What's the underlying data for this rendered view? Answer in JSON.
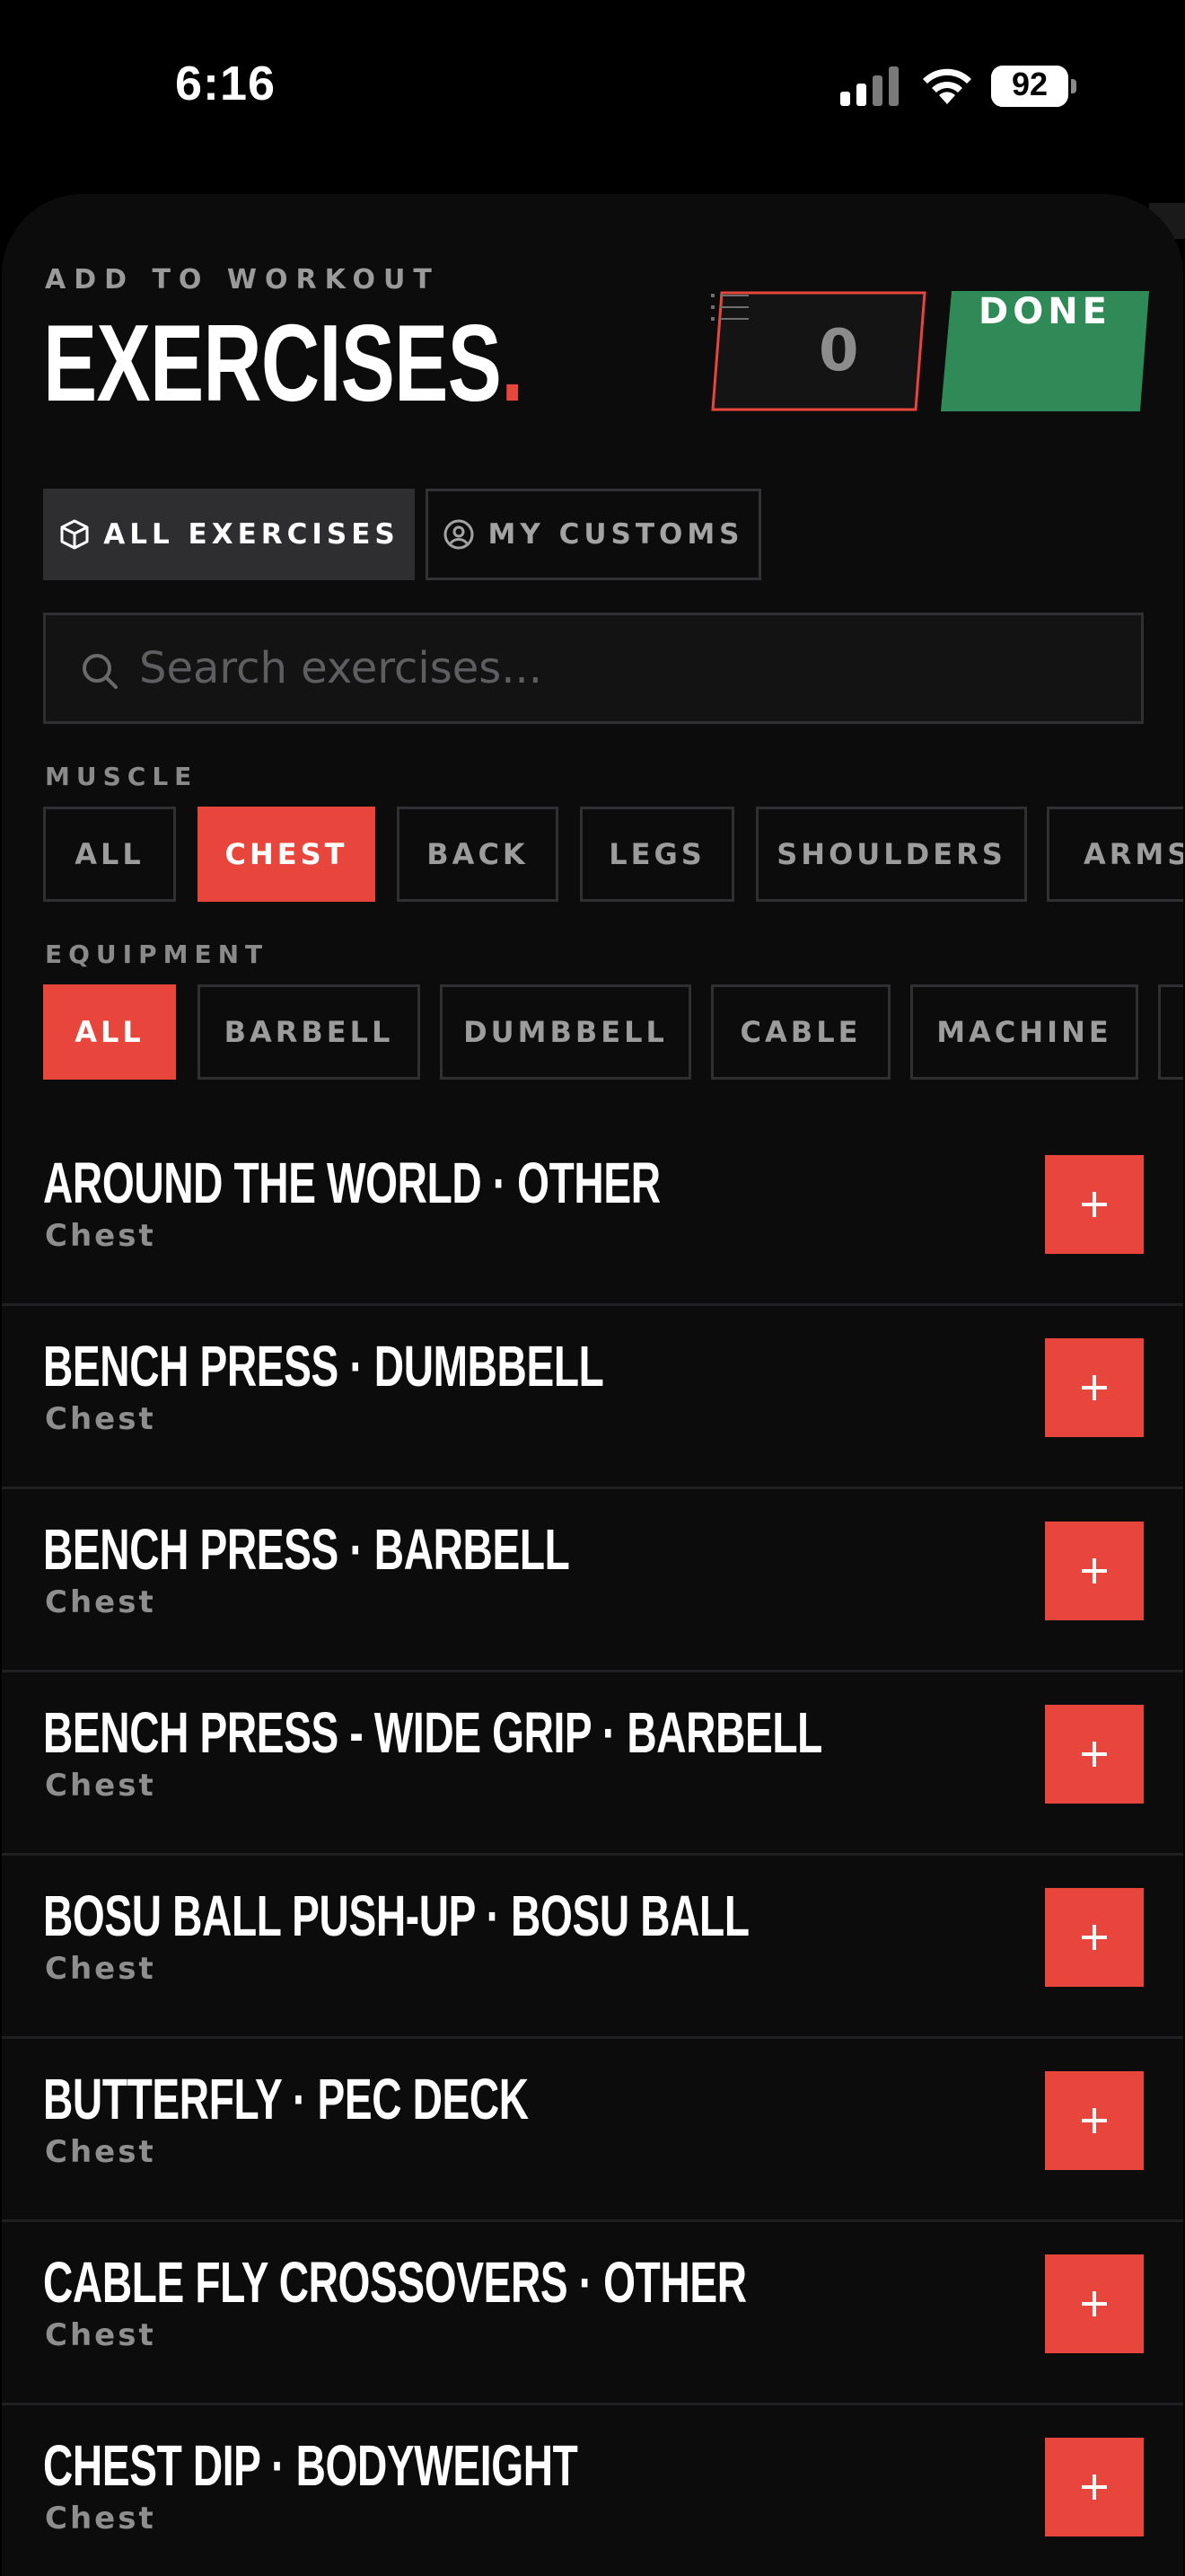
{
  "status_bar": {
    "time": "6:16",
    "battery_level": "92",
    "icons": [
      "signal-icon",
      "wifi-icon",
      "battery-icon"
    ]
  },
  "header": {
    "kicker": "ADD TO WORKOUT",
    "title": "EXERCISES",
    "title_dot": ".",
    "selected_count": "0",
    "done_label": "DONE"
  },
  "tabs": {
    "all": "ALL EXERCISES",
    "custom": "MY CUSTOMS",
    "active": "all"
  },
  "search": {
    "placeholder": "Search exercises...",
    "value": ""
  },
  "muscle_filter": {
    "label": "MUSCLE",
    "options": [
      "ALL",
      "CHEST",
      "BACK",
      "LEGS",
      "SHOULDERS",
      "ARMS"
    ],
    "selected": "CHEST"
  },
  "equipment_filter": {
    "label": "EQUIPMENT",
    "options": [
      "ALL",
      "BARBELL",
      "DUMBBELL",
      "CABLE",
      "MACHINE"
    ],
    "selected": "ALL"
  },
  "exercises": [
    {
      "name": "AROUND THE WORLD · OTHER",
      "muscle": "Chest"
    },
    {
      "name": "BENCH PRESS · DUMBBELL",
      "muscle": "Chest"
    },
    {
      "name": "BENCH PRESS · BARBELL",
      "muscle": "Chest"
    },
    {
      "name": "BENCH PRESS - WIDE GRIP · BARBELL",
      "muscle": "Chest"
    },
    {
      "name": "BOSU BALL PUSH-UP · BOSU BALL",
      "muscle": "Chest"
    },
    {
      "name": "BUTTERFLY · PEC DECK",
      "muscle": "Chest"
    },
    {
      "name": "CABLE FLY CROSSOVERS · OTHER",
      "muscle": "Chest"
    },
    {
      "name": "CHEST DIP · BODYWEIGHT",
      "muscle": "Chest"
    }
  ],
  "colors": {
    "accent": "#e8453c",
    "done": "#2f8a57",
    "background": "#0c0c0d"
  }
}
